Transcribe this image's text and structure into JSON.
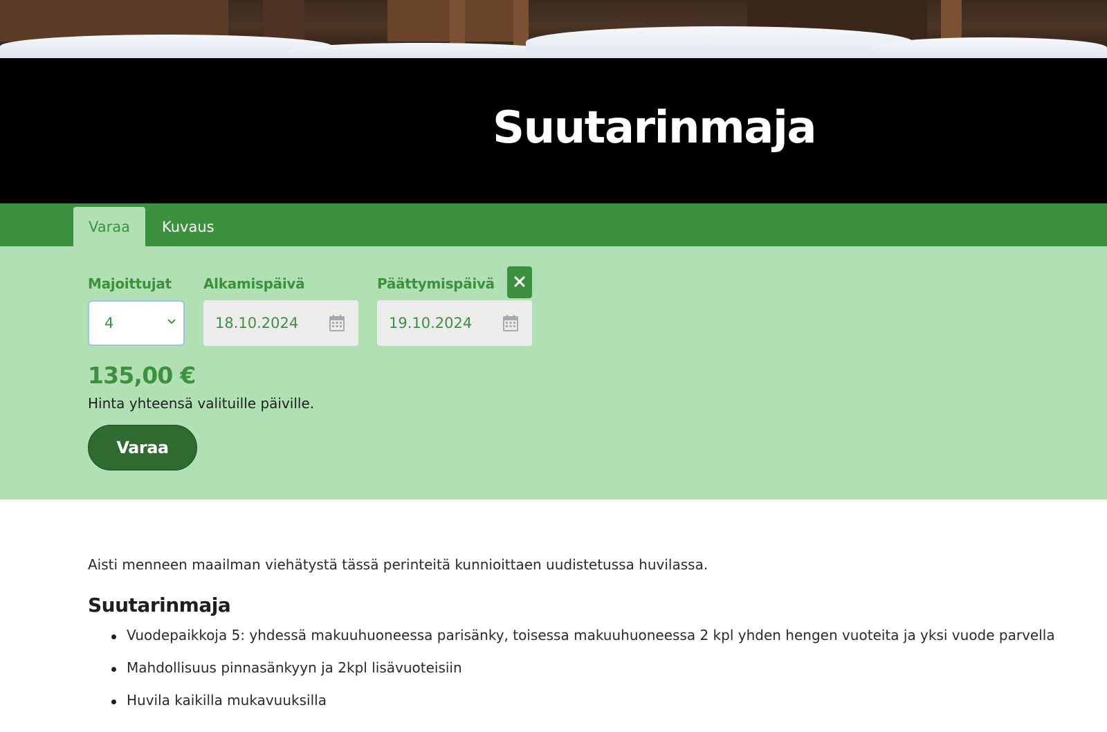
{
  "title": "Suutarinmaja",
  "tabs": [
    {
      "label": "Varaa",
      "active": true
    },
    {
      "label": "Kuvaus",
      "active": false
    }
  ],
  "booking": {
    "guests_label": "Majoittujat",
    "guests_value": "4",
    "start_label": "Alkamispäivä",
    "start_value": "18.10.2024",
    "end_label": "Päättymispäivä",
    "end_value": "19.10.2024",
    "clear_icon": "close-icon",
    "price": "135,00 €",
    "price_note": "Hinta yhteensä valituille päiville.",
    "book_label": "Varaa"
  },
  "description": {
    "intro": "Aisti menneen maailman viehätystä tässä perinteitä kunnioittaen uudistetussa huvilassa.",
    "heading": "Suutarinmaja",
    "features": [
      "Vuodepaikkoja 5: yhdessä makuuhuoneessa parisänky, toisessa makuuhuoneessa 2 kpl yhden hengen vuoteita ja yksi vuode parvella",
      "Mahdollisuus pinnasänkyyn ja 2kpl lisävuoteisiin",
      "Huvila kaikilla mukavuuksilla"
    ]
  },
  "colors": {
    "brand_green": "#3c913f",
    "panel_green": "#b2e0b5",
    "button_green": "#2e6b30",
    "title_band": "#000000"
  }
}
